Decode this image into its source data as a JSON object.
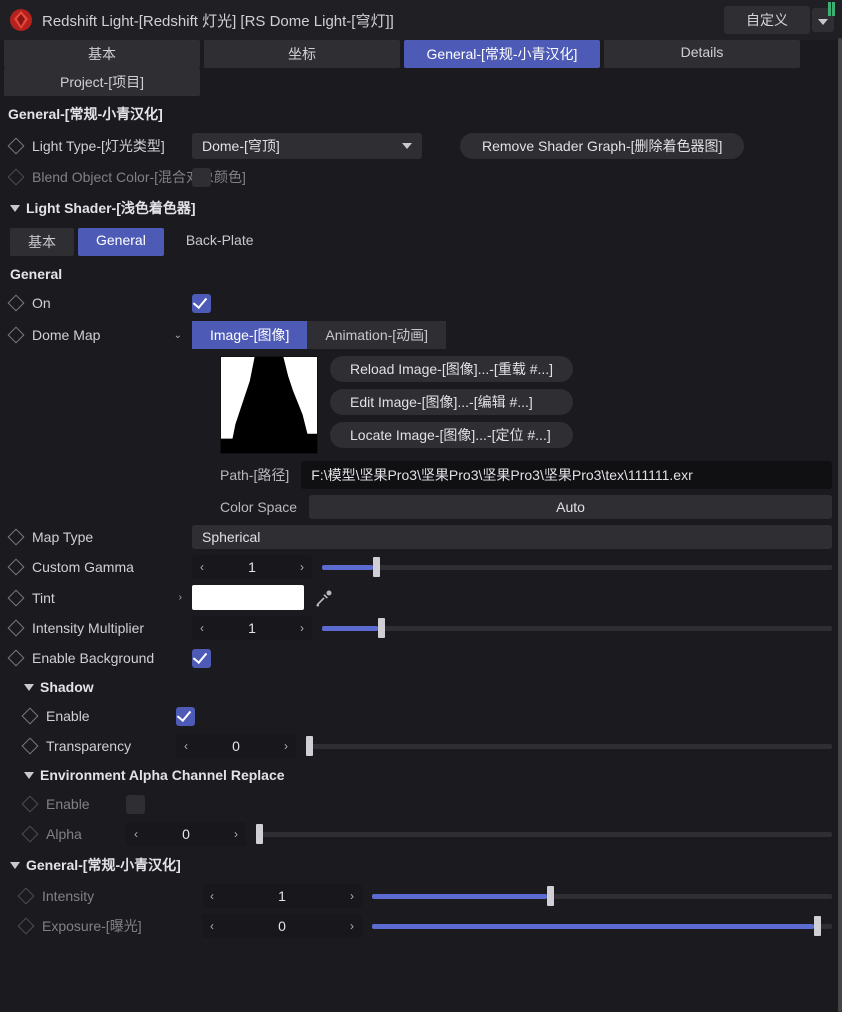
{
  "titlebar": {
    "title": "Redshift Light-[Redshift 灯光] [RS Dome Light-[穹灯]]",
    "custom": "自定义"
  },
  "tabs": {
    "basic": "基本",
    "coord": "坐标",
    "general": "General-[常规-小青汉化]",
    "details": "Details",
    "project": "Project-[项目]"
  },
  "sectionGeneral": "General-[常规-小青汉化]",
  "lightType": {
    "label": "Light Type-[灯光类型]",
    "value": "Dome-[穹顶]"
  },
  "removeShader": "Remove Shader Graph-[删除着色器图]",
  "blendObj": "Blend Object Color-[混合对象颜色]",
  "lightShader": {
    "title": "Light Shader-[浅色着色器]",
    "basic": "基本",
    "general": "General",
    "backplate": "Back-Plate"
  },
  "general2": "General",
  "on": "On",
  "domeMap": {
    "label": "Dome Map",
    "image": "Image-[图像]",
    "animation": "Animation-[动画]",
    "reload": "Reload Image-[图像]...-[重载 #...]",
    "edit": "Edit Image-[图像]...-[编辑 #...]",
    "locate": "Locate Image-[图像]...-[定位 #...]",
    "pathLabel": "Path-[路径]",
    "pathValue": "F:\\模型\\坚果Pro3\\坚果Pro3\\坚果Pro3\\坚果Pro3\\tex\\111111.exr",
    "colorSpaceLabel": "Color Space",
    "colorSpaceValue": "Auto"
  },
  "mapType": {
    "label": "Map Type",
    "value": "Spherical"
  },
  "customGamma": {
    "label": "Custom Gamma",
    "value": "1"
  },
  "tint": "Tint",
  "intensityMult": {
    "label": "Intensity Multiplier",
    "value": "1"
  },
  "enableBg": "Enable Background",
  "shadow": {
    "title": "Shadow",
    "enable": "Enable",
    "transparency": {
      "label": "Transparency",
      "value": "0"
    }
  },
  "envAlpha": {
    "title": "Environment Alpha Channel Replace",
    "enable": "Enable",
    "alpha": {
      "label": "Alpha",
      "value": "0"
    }
  },
  "general3": {
    "title": "General-[常规-小青汉化]",
    "intensity": {
      "label": "Intensity",
      "value": "1"
    },
    "exposure": {
      "label": "Exposure-[曝光]",
      "value": "0"
    }
  }
}
